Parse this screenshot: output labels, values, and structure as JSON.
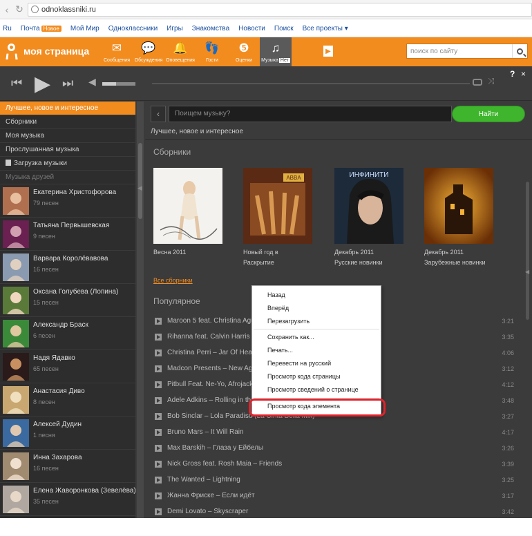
{
  "browser": {
    "url": "odnoklassniki.ru"
  },
  "portal": {
    "links": [
      "Ru",
      "Почта",
      "Мой Мир",
      "Одноклассники",
      "Игры",
      "Знакомства",
      "Новости",
      "Поиск",
      "Все проекты ▾"
    ],
    "mail_badge": "Новое"
  },
  "header": {
    "title": "моя страница",
    "nav": [
      {
        "label": "Сообщения",
        "icon": "envelope-icon"
      },
      {
        "label": "Обсуждения",
        "icon": "chat-icon"
      },
      {
        "label": "Оповещения",
        "icon": "bell-icon"
      },
      {
        "label": "Гости",
        "icon": "footprints-icon"
      },
      {
        "label": "Оценки",
        "icon": "rating-icon"
      },
      {
        "label": "Музыка",
        "icon": "music-note-icon",
        "badge": "Нет"
      }
    ],
    "search_placeholder": "поиск по сайту",
    "accent": "#f28c1f"
  },
  "player": {
    "help": "?",
    "close": "×"
  },
  "left_menu": {
    "items": [
      {
        "label": "Лучшее, новое и интересное",
        "selected": true
      },
      {
        "label": "Сборники"
      },
      {
        "label": "Моя музыка"
      },
      {
        "label": "Прослушанная музыка"
      },
      {
        "label": "Загрузка музыки",
        "icon": "download-icon"
      },
      {
        "label": "Музыка друзей",
        "section": true
      }
    ],
    "friends": [
      {
        "name": "Екатерина Христофорова",
        "count": "79 песен"
      },
      {
        "name": "Татьяна Первышевская",
        "count": "9 песен"
      },
      {
        "name": "Варвара Королёвавова",
        "count": "16 песен"
      },
      {
        "name": "Оксана Голубева (Лопина)",
        "count": "15 песен"
      },
      {
        "name": "Александр Браск",
        "count": "6 песен"
      },
      {
        "name": "Надя Ядавко",
        "count": "65 песен"
      },
      {
        "name": "Анастасия Диво",
        "count": "8 песен"
      },
      {
        "name": "Алексей Дудин",
        "count": "1 песня"
      },
      {
        "name": "Инна Захарова",
        "count": "16 песен"
      },
      {
        "name": "Елена Жаворонкова (Зевелёва)",
        "count": "35 песен"
      }
    ]
  },
  "main": {
    "search_placeholder": "Поищем музыку?",
    "find_button": "Найти",
    "breadcrumb": "Лучшее, новое и интересное",
    "compilations_title": "Сборники",
    "albums": [
      {
        "title": "Весна 2011",
        "sub": ""
      },
      {
        "title": "Новый год в",
        "sub": "Раскрытие"
      },
      {
        "title": "Декабрь 2011",
        "sub": "Русские новинки"
      },
      {
        "title": "Декабрь 2011",
        "sub": "Зарубежные новинки"
      }
    ],
    "all_compilations": "Все сборники",
    "popular_title": "Популярное",
    "tracks": [
      {
        "title": "Maroon 5 feat. Christina Aguilera – Moves Like Jagger",
        "dur": "3:21"
      },
      {
        "title": "Rihanna feat. Calvin Harris – We Found Love",
        "dur": "3:35"
      },
      {
        "title": "Christina Perri – Jar Of Hearts",
        "dur": "4:06"
      },
      {
        "title": "Madcon Presents – New Age",
        "dur": "3:12"
      },
      {
        "title": "Pitbull Feat. Ne-Yo, Afrojack – Give Me Everything",
        "dur": "4:12"
      },
      {
        "title": "Adele Adkins – Rolling in the Deep",
        "dur": "3:48"
      },
      {
        "title": "Bob Sinclar – Lola Paradiso (La Cinta Bella Mix)",
        "dur": "3:27"
      },
      {
        "title": "Bruno Mars – It Will Rain",
        "dur": "4:17"
      },
      {
        "title": "Max Barskih – Глаза у Ейбелы",
        "dur": "3:26"
      },
      {
        "title": "Nick Gross feat. Rosh Maia – Friends",
        "dur": "3:39"
      },
      {
        "title": "The Wanted – Lightning",
        "dur": "3:25"
      },
      {
        "title": "Жанна Фриске – Если идёт",
        "dur": "3:17"
      },
      {
        "title": "Demi Lovato – Skyscraper",
        "dur": "3:42"
      }
    ]
  },
  "context_menu": {
    "items": [
      "Назад",
      "Вперёд",
      "Перезагрузить",
      "Сохранить как...",
      "Печать...",
      "Перевести на русский",
      "Просмотр кода страницы",
      "Просмотр сведений о странице",
      "Просмотр кода элемента"
    ],
    "highlighted": "Просмотр кода элемента"
  }
}
